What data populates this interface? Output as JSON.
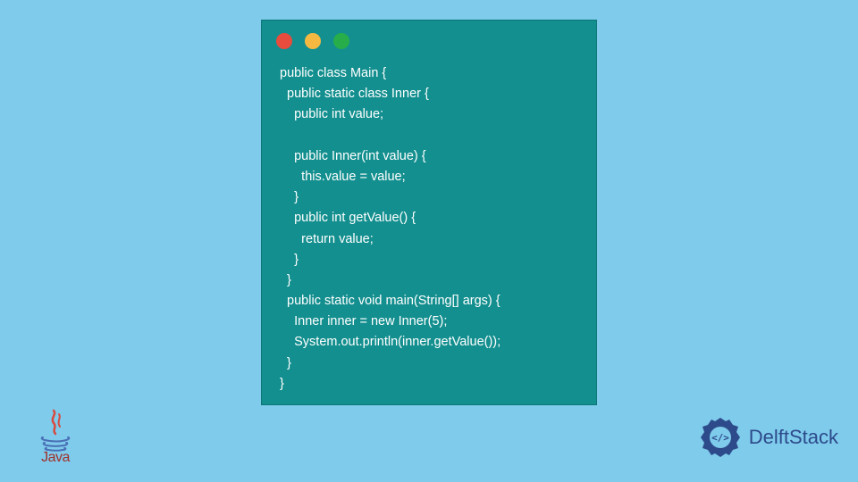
{
  "code": {
    "lines": [
      "public class Main {",
      "  public static class Inner {",
      "    public int value;",
      "",
      "    public Inner(int value) {",
      "      this.value = value;",
      "    }",
      "    public int getValue() {",
      "      return value;",
      "    }",
      "  }",
      "  public static void main(String[] args) {",
      "    Inner inner = new Inner(5);",
      "    System.out.println(inner.getValue());",
      "  }",
      "}"
    ]
  },
  "java": {
    "label": "Java"
  },
  "delft": {
    "label": "DelftStack"
  }
}
